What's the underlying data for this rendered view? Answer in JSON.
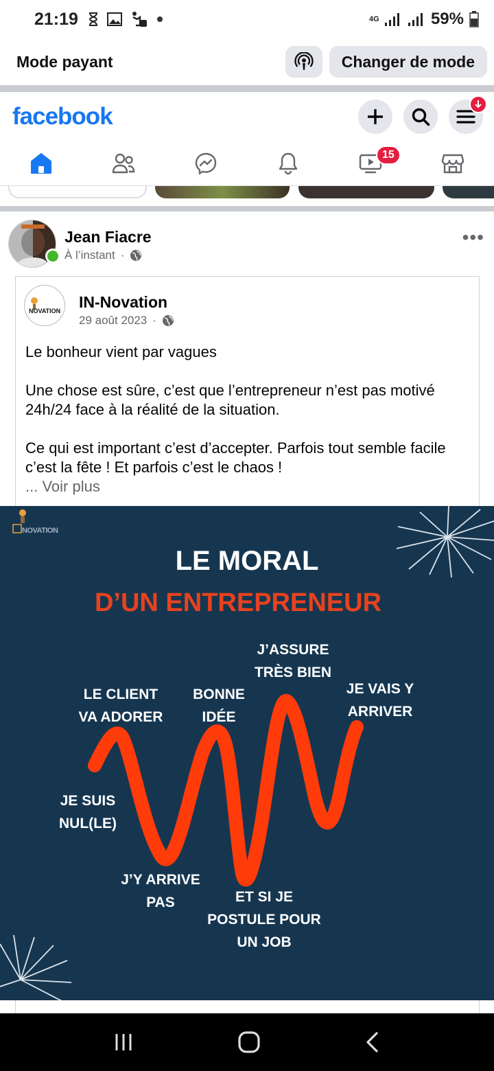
{
  "status_bar": {
    "time": "21:19",
    "network": "4G",
    "battery": "59%"
  },
  "mode_bar": {
    "label": "Mode payant",
    "change_button": "Changer de mode"
  },
  "header": {
    "logo": "facebook"
  },
  "nav": {
    "video_badge": "15"
  },
  "post": {
    "author": "Jean Fiacre",
    "time": "À l’instant",
    "privacy_sep": "·",
    "shared": {
      "page_name": "IN-Novation",
      "date": "29 août 2023",
      "sep": "·",
      "logo_text": "NOVATION",
      "paragraphs": [
        "Le bonheur vient par vagues",
        "Une chose est sûre, c’est que l’entrepreneur n’est pas motivé 24h/24 face à la réalité de la situation.",
        "Ce qui est important c’est d’accepter. Parfois tout semble facile c’est la fête !  Et parfois c’est le chaos !"
      ],
      "see_more": "... Voir plus"
    },
    "image": {
      "watermark": "NOVATION",
      "title": "LE MORAL",
      "subtitle": "D’UN ENTREPRENEUR",
      "labels": {
        "client_1": "LE CLIENT",
        "client_2": "VA ADORER",
        "bonne_1": "BONNE",
        "bonne_2": "IDÉE",
        "assure_1": "J’ASSURE",
        "assure_2": "TRÈS BIEN",
        "vais_1": "JE VAIS Y",
        "vais_2": "ARRIVER",
        "nul_1": "JE SUIS",
        "nul_2": "NUL(LE)",
        "arrive_1": "J’Y ARRIVE",
        "arrive_2": "PAS",
        "job_1": "ET SI JE",
        "job_2": "POSTULE POUR",
        "job_3": "UN JOB"
      }
    }
  },
  "colors": {
    "brand": "#1877f2",
    "badge": "#e41e3f",
    "poster_bg": "#163650",
    "poster_accent": "#e8421e"
  }
}
